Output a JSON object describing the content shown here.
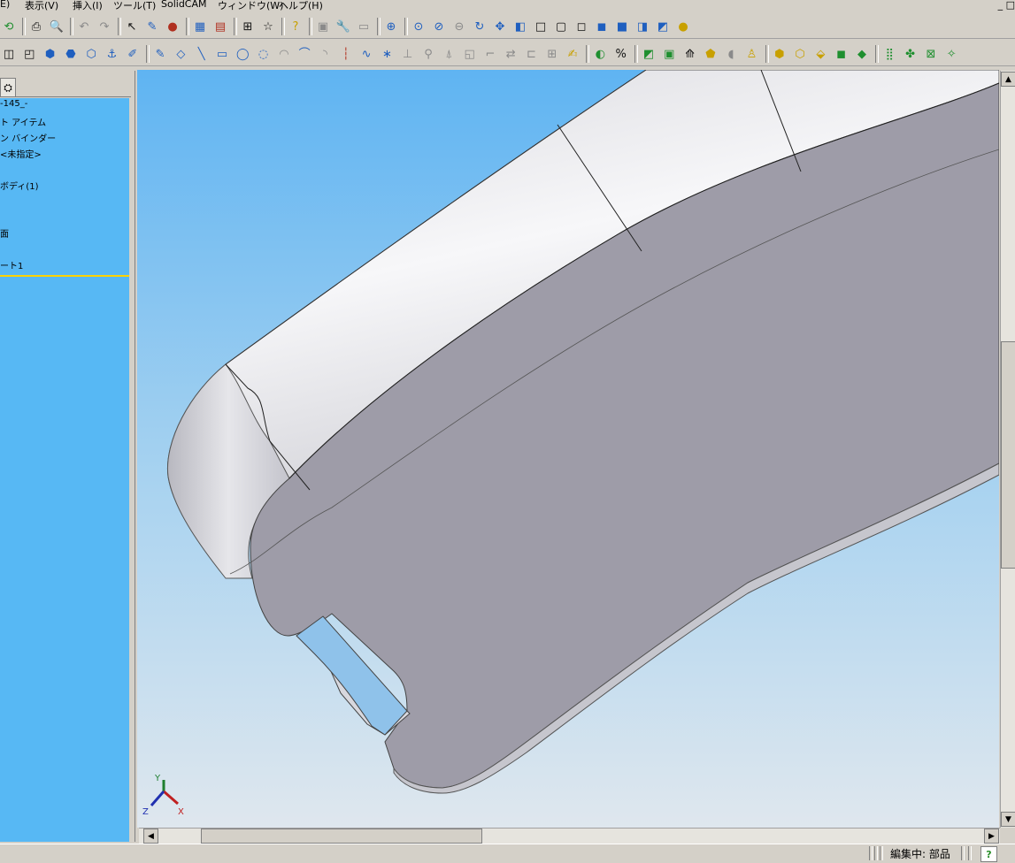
{
  "menu": {
    "items": [
      "E)",
      "表示(V)",
      "挿入(I)",
      "ツール(T)",
      "SolidCAM",
      "ウィンドウ(W)",
      "ヘルプ(H)"
    ],
    "window_controls": "_ □"
  },
  "toolbar1": {
    "icons": [
      "rebuild-icon",
      "print-icon",
      "print-preview-icon",
      "undo-icon",
      "redo-icon",
      "select-icon",
      "sketch-icon",
      "traffic-light-icon",
      "grid-icon",
      "brick-icon",
      "dimension-icon",
      "smart-select-icon",
      "help-icon",
      "assembly-icon",
      "wrench-icon",
      "view-icon",
      "zoom-fit-icon",
      "zoom-area-icon",
      "zoom-inout-icon",
      "zoom-selection-icon",
      "rotate-icon",
      "pan-icon",
      "standard-views-icon",
      "wireframe-icon",
      "hidden-lines-icon",
      "hidden-removed-icon",
      "shaded-edges-icon",
      "shaded-icon",
      "section-view-icon",
      "perspective-icon",
      "render-sphere-icon"
    ]
  },
  "toolbar2": {
    "icons": [
      "extrude-icon",
      "revolve-icon",
      "box-blue-icon",
      "cylinder-blue-icon",
      "shell-blue-icon",
      "anchor-icon",
      "brush-icon",
      "sketch-pencil-icon",
      "smart-dim-icon",
      "line-icon",
      "rectangle-icon",
      "circle-icon",
      "arc-icon",
      "tangent-arc-icon",
      "centerpoint-arc-icon",
      "three-point-arc-icon",
      "centerline-icon",
      "spline-icon",
      "point-icon",
      "relation-icon",
      "fix-icon",
      "mirror-icon",
      "offset-icon",
      "trim-icon",
      "extend-icon",
      "convert-icon",
      "pattern-icon",
      "3d-sketch-icon",
      "display-style-icon",
      "hide-show-icon",
      "feature-tool-1",
      "feature-tool-2",
      "feature-tool-3",
      "feature-tool-4",
      "feature-tool-5",
      "feature-tool-6",
      "solid-tool-1",
      "solid-tool-2",
      "solid-tool-3",
      "solid-tool-4",
      "solid-tool-5",
      "array-icon",
      "move-copy-icon",
      "split-icon",
      "pin-icon"
    ]
  },
  "panel": {
    "tree_items": [
      "-145_-",
      "ト アイテム",
      "ン バインダー",
      "<未指定>",
      "ボディ(1)",
      "面",
      "ート1"
    ]
  },
  "status": {
    "mode_text": "編集中: 部品",
    "help_label": "?"
  },
  "triad": {
    "x_label": "X",
    "y_label": "Y",
    "z_label": "Z"
  },
  "colors": {
    "viewport_top": "#5fb4f2",
    "viewport_bottom": "#dfe7ee",
    "body_face": "#9e9ca8",
    "panel_bg": "#57b8f4",
    "selection_line": "#ffd200"
  }
}
